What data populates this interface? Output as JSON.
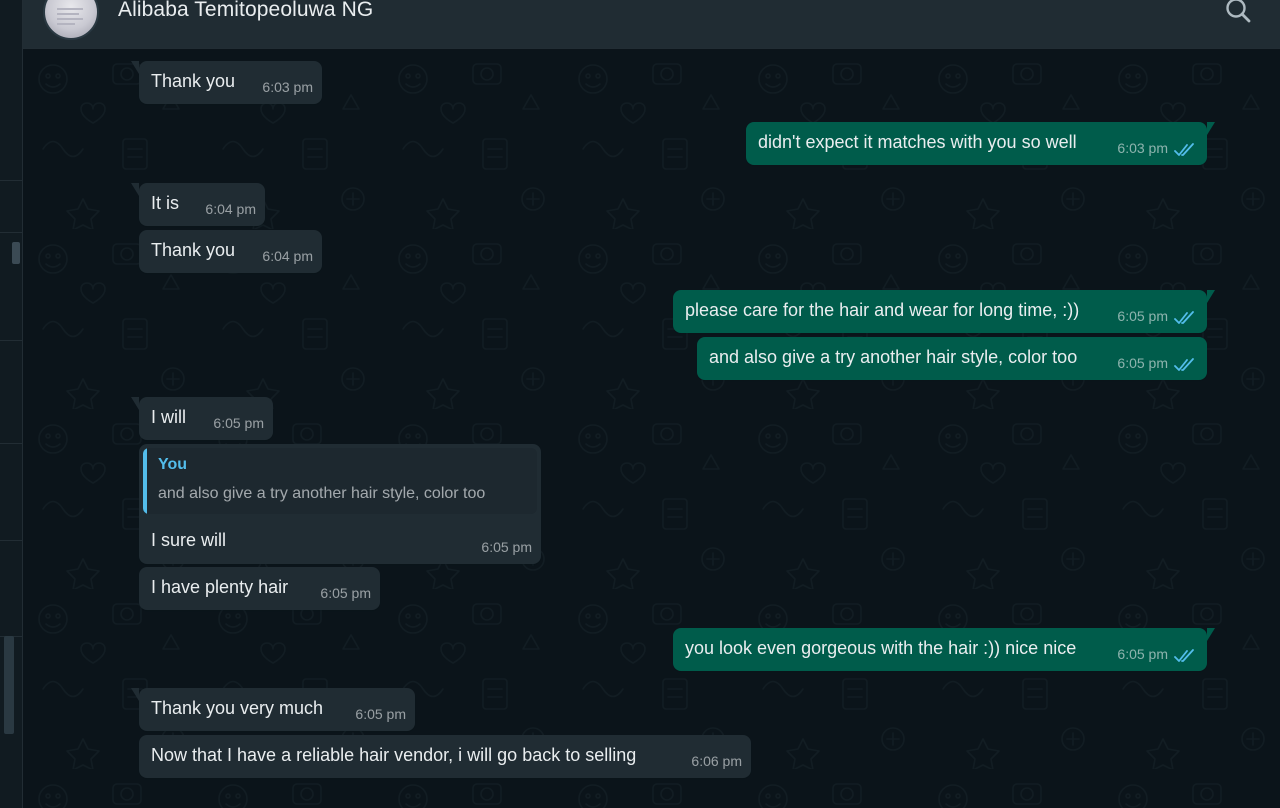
{
  "header": {
    "contact_name": "Alibaba Temitopeoluwa NG",
    "search_icon": "search-icon"
  },
  "colors": {
    "background": "#0b141a",
    "header": "#202c33",
    "incoming_bubble": "#202c33",
    "outgoing_bubble": "#005c4b",
    "read_ticks": "#53bdeb",
    "quote_accent": "#53bdeb",
    "text": "#e9edef"
  },
  "messages": [
    {
      "direction": "in",
      "text": "Thank you",
      "time": "6:03 pm"
    },
    {
      "direction": "out",
      "text": "didn't expect it matches with you so well",
      "time": "6:03 pm",
      "status": "read"
    },
    {
      "direction": "in",
      "text": "It is",
      "time": "6:04 pm"
    },
    {
      "direction": "in",
      "text": "Thank you",
      "time": "6:04 pm"
    },
    {
      "direction": "out",
      "text": "please care for the hair and wear for long time, :))",
      "time": "6:05 pm",
      "status": "read"
    },
    {
      "direction": "out",
      "text": "and also give a try another hair style, color too",
      "time": "6:05 pm",
      "status": "read"
    },
    {
      "direction": "in",
      "text": "I will",
      "time": "6:05 pm"
    },
    {
      "direction": "in",
      "text": "I sure will",
      "time": "6:05 pm",
      "quote": {
        "author": "You",
        "text": "and also give a try another hair style, color too"
      }
    },
    {
      "direction": "in",
      "text": "I have plenty hair",
      "time": "6:05 pm"
    },
    {
      "direction": "out",
      "text": "you look even gorgeous with the hair :)) nice nice",
      "time": "6:05 pm",
      "status": "read"
    },
    {
      "direction": "in",
      "text": "Thank you very much",
      "time": "6:05 pm"
    },
    {
      "direction": "in",
      "text": "Now that I have a reliable hair vendor, i will go back to selling",
      "time": "6:06 pm"
    }
  ]
}
